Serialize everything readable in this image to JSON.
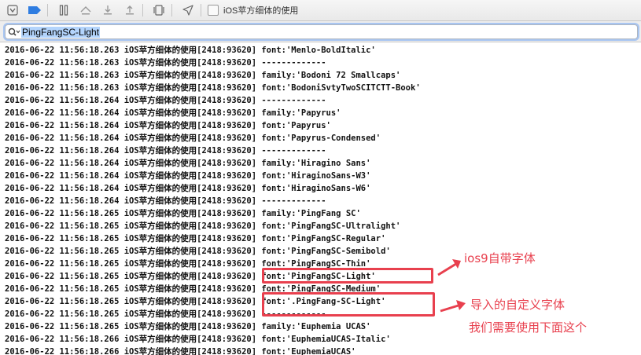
{
  "toolbar": {
    "icons": [
      "hide-debug-area-icon",
      "breakpoints-toggle-icon",
      "pause-icon",
      "step-over-icon",
      "step-into-icon",
      "step-out-icon",
      "debug-view-hierarchy-icon",
      "simulate-location-icon",
      "target-app-icon"
    ],
    "breadcrumb": "iOS苹方细体的使用"
  },
  "filter": {
    "value": "PingFangSC-Light"
  },
  "log": {
    "lines": [
      "2016-06-22 11:56:18.263 iOS苹方细体的使用[2418:93620] font:'Menlo-BoldItalic'",
      "2016-06-22 11:56:18.263 iOS苹方细体的使用[2418:93620] -------------",
      "2016-06-22 11:56:18.263 iOS苹方细体的使用[2418:93620] family:'Bodoni 72 Smallcaps'",
      "2016-06-22 11:56:18.263 iOS苹方细体的使用[2418:93620] font:'BodoniSvtyTwoSCITCTT-Book'",
      "2016-06-22 11:56:18.264 iOS苹方细体的使用[2418:93620] -------------",
      "2016-06-22 11:56:18.264 iOS苹方细体的使用[2418:93620] family:'Papyrus'",
      "2016-06-22 11:56:18.264 iOS苹方细体的使用[2418:93620] font:'Papyrus'",
      "2016-06-22 11:56:18.264 iOS苹方细体的使用[2418:93620] font:'Papyrus-Condensed'",
      "2016-06-22 11:56:18.264 iOS苹方细体的使用[2418:93620] -------------",
      "2016-06-22 11:56:18.264 iOS苹方细体的使用[2418:93620] family:'Hiragino Sans'",
      "2016-06-22 11:56:18.264 iOS苹方细体的使用[2418:93620] font:'HiraginoSans-W3'",
      "2016-06-22 11:56:18.264 iOS苹方细体的使用[2418:93620] font:'HiraginoSans-W6'",
      "2016-06-22 11:56:18.264 iOS苹方细体的使用[2418:93620] -------------",
      "2016-06-22 11:56:18.265 iOS苹方细体的使用[2418:93620] family:'PingFang SC'",
      "2016-06-22 11:56:18.265 iOS苹方细体的使用[2418:93620] font:'PingFangSC-Ultralight'",
      "2016-06-22 11:56:18.265 iOS苹方细体的使用[2418:93620] font:'PingFangSC-Regular'",
      "2016-06-22 11:56:18.265 iOS苹方细体的使用[2418:93620] font:'PingFangSC-Semibold'",
      "2016-06-22 11:56:18.265 iOS苹方细体的使用[2418:93620] font:'PingFangSC-Thin'",
      "2016-06-22 11:56:18.265 iOS苹方细体的使用[2418:93620] font:'PingFangSC-Light'",
      "2016-06-22 11:56:18.265 iOS苹方细体的使用[2418:93620] font:'PingFangSC-Medium'",
      "2016-06-22 11:56:18.265 iOS苹方细体的使用[2418:93620] font:'.PingFang-SC-Light'",
      "2016-06-22 11:56:18.265 iOS苹方细体的使用[2418:93620] -------------",
      "2016-06-22 11:56:18.265 iOS苹方细体的使用[2418:93620] family:'Euphemia UCAS'",
      "2016-06-22 11:56:18.266 iOS苹方细体的使用[2418:93620] font:'EuphemiaUCAS-Italic'",
      "2016-06-22 11:56:18.266 iOS苹方细体的使用[2418:93620] font:'EuphemiaUCAS'"
    ]
  },
  "annotations": {
    "first": "ios9自带字体",
    "second_line1": "导入的自定义字体",
    "second_line2": "我们需要使用下面这个",
    "color": "#e8404e"
  }
}
